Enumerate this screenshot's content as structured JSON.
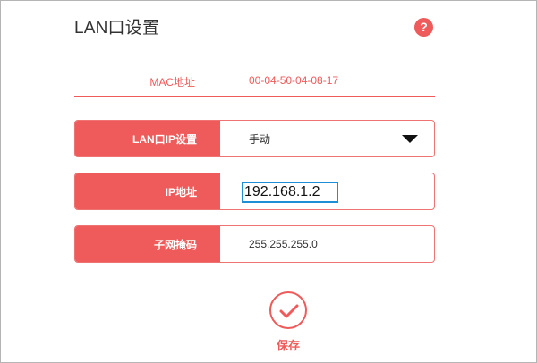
{
  "page": {
    "title": "LAN口设置",
    "help_icon": "help-icon",
    "help_symbol": "?"
  },
  "mac": {
    "label": "MAC地址",
    "value": "00-04-50-04-08-17"
  },
  "fields": {
    "lan_ip_mode": {
      "label": "LAN口IP设置",
      "value": "手动"
    },
    "ip_address": {
      "label": "IP地址",
      "value": "192.168.1.2"
    },
    "subnet_mask": {
      "label": "子网掩码",
      "value": "255.255.255.0"
    }
  },
  "save": {
    "label": "保存",
    "icon": "checkmark-icon"
  },
  "colors": {
    "accent": "#ef5b5b",
    "focus_border": "#1c8fd6"
  }
}
